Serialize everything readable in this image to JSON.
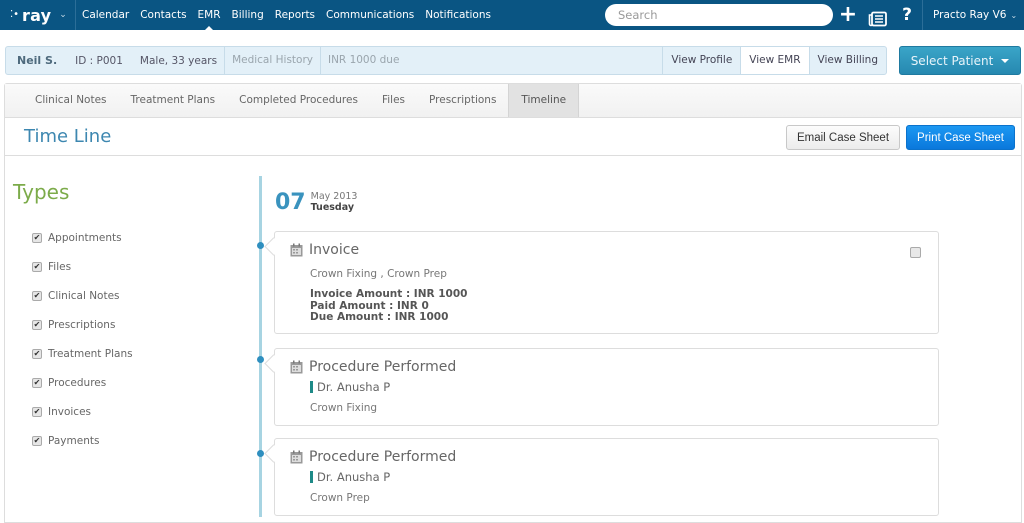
{
  "topnav": {
    "brand": "ray",
    "links": [
      "Calendar",
      "Contacts",
      "EMR",
      "Billing",
      "Reports",
      "Communications",
      "Notifications"
    ],
    "active_link": "EMR",
    "search_placeholder": "Search",
    "account": "Practo Ray V6",
    "icons": {
      "add": "+",
      "help": "?"
    }
  },
  "patient": {
    "name": "Neil S.",
    "id": "ID : P001",
    "info": "Male, 33 years",
    "medical_history": "Medical History",
    "due": "INR 1000 due",
    "buttons": [
      "View Profile",
      "View EMR",
      "View Billing"
    ],
    "active_button": "View EMR",
    "select_patient": "Select Patient"
  },
  "tabs": [
    "Clinical Notes",
    "Treatment Plans",
    "Completed Procedures",
    "Files",
    "Prescriptions",
    "Timeline"
  ],
  "active_tab": "Timeline",
  "page_title": "Time Line",
  "actions": {
    "email": "Email Case Sheet",
    "print": "Print Case Sheet"
  },
  "types": {
    "title": "Types",
    "items": [
      {
        "label": "Appointments",
        "checked": true
      },
      {
        "label": "Files",
        "checked": true
      },
      {
        "label": "Clinical Notes",
        "checked": true
      },
      {
        "label": "Prescriptions",
        "checked": true
      },
      {
        "label": "Treatment Plans",
        "checked": true
      },
      {
        "label": "Procedures",
        "checked": true
      },
      {
        "label": "Invoices",
        "checked": true
      },
      {
        "label": "Payments",
        "checked": true
      }
    ]
  },
  "timeline": {
    "date": {
      "day": "07",
      "month_year": "May 2013",
      "weekday": "Tuesday"
    },
    "entries": [
      {
        "title": "Invoice",
        "subtitle": "Crown Fixing , Crown Prep",
        "amounts": [
          "Invoice Amount : INR 1000",
          "Paid Amount : INR 0",
          "Due Amount : INR 1000"
        ],
        "selected": false
      },
      {
        "title": "Procedure Performed",
        "doctor": "Dr. Anusha P",
        "subtitle": "Crown Fixing"
      },
      {
        "title": "Procedure Performed",
        "doctor": "Dr. Anusha P",
        "subtitle": "Crown Prep"
      }
    ]
  },
  "colors": {
    "nav_bg": "#0a5583",
    "accent_blue": "#3d87b0",
    "types_green": "#7cab4a",
    "print_button": "#1488e6",
    "doctor_marker": "#1e8a87"
  }
}
